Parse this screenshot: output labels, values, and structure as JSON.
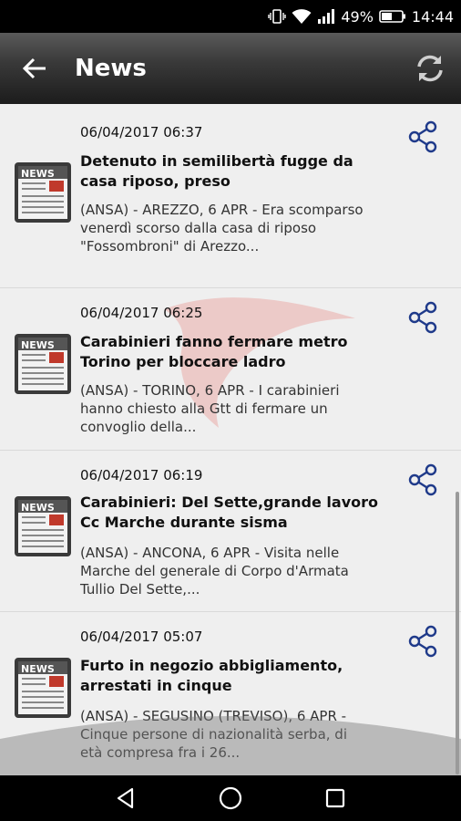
{
  "status_bar": {
    "battery_percent": "49%",
    "time": "14:44"
  },
  "app_bar": {
    "title": "News"
  },
  "news": [
    {
      "date": "06/04/2017 06:37",
      "title": "Detenuto in semilibertà fugge da casa riposo, preso",
      "summary": "(ANSA) - AREZZO, 6 APR - Era scomparso venerdì scorso dalla casa di riposo \"Fossombroni\" di Arezzo..."
    },
    {
      "date": "06/04/2017 06:25",
      "title": "Carabinieri fanno fermare metro Torino per bloccare ladro",
      "summary": "(ANSA) - TORINO, 6 APR - I carabinieri hanno chiesto alla Gtt di fermare un convoglio della..."
    },
    {
      "date": "06/04/2017 06:19",
      "title": "Carabinieri: Del Sette,grande lavoro Cc Marche durante sisma",
      "summary": "(ANSA) - ANCONA, 6 APR - Visita nelle Marche del generale di Corpo d'Armata Tullio Del Sette,..."
    },
    {
      "date": "06/04/2017 05:07",
      "title": "Furto in negozio abbigliamento, arrestati in cinque",
      "summary": "(ANSA) - SEGUSINO (TREVISO), 6 APR - Cinque persone di nazionalità serba, di età compresa fra i 26..."
    }
  ],
  "thumbnail_label": "NEWS",
  "colors": {
    "share_icon": "#1f3a8a",
    "app_bar": "#2a2a2a",
    "content_bg": "#efefef"
  }
}
